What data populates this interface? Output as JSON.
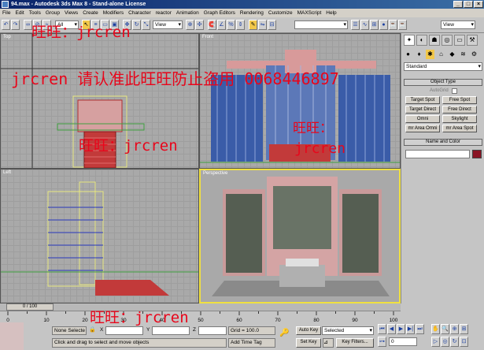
{
  "window": {
    "title": "94.max - Autodesk 3ds Max 8 - Stand-alone License",
    "min": "_",
    "max": "□",
    "close": "×"
  },
  "menu": [
    "File",
    "Edit",
    "Tools",
    "Group",
    "Views",
    "Create",
    "Modifiers",
    "Character",
    "reactor",
    "Animation",
    "Graph Editors",
    "Rendering",
    "Customize",
    "MAXScript",
    "Help"
  ],
  "toolbar": {
    "filter": "All",
    "refcoord": "View",
    "selset": "",
    "view2": "View"
  },
  "viewports": {
    "top": "Top",
    "front": "Front",
    "left": "Left",
    "perspective": "Perspective"
  },
  "cmdpanel": {
    "category": "Standard",
    "object_type": "Object Type",
    "autogrid": "AutoGrid",
    "buttons": [
      "Target Spot",
      "Free Spot",
      "Target Direct",
      "Free Direct",
      "Omni",
      "Skylight",
      "mr Area Omni",
      "mr Area Spot"
    ],
    "name_color": "Name and Color",
    "name_value": ""
  },
  "timeline": {
    "slider": "0 / 100",
    "ticks": [
      "0",
      "10",
      "20",
      "30",
      "40",
      "50",
      "60",
      "70",
      "80",
      "90",
      "100"
    ]
  },
  "status": {
    "selection": "None Selecte",
    "x_label": "X",
    "x_value": "",
    "y_label": "Y",
    "y_value": "",
    "z_label": "Z",
    "z_value": "",
    "grid": "Grid = 100.0",
    "prompt": "Click and drag to select and move objects",
    "add_time_tag": "Add Time Tag",
    "auto_key": "Auto Key",
    "set_key": "Set Key",
    "key_mode": "Selected",
    "key_filters": "Key Filters...",
    "frame": "0"
  },
  "watermarks": [
    "旺旺：jrcren",
    "jrcren 请认准此旺旺防止盗用 0068446897",
    "旺旺：jrcren",
    "旺旺：",
    "jrcren",
    "旺旺：jrcren"
  ],
  "colors": {
    "wm": "#e8061b",
    "viewport_bg": "#a9a9a9",
    "building_roof": "#d89a9a",
    "building_glass": "#3a5ca8",
    "persp_border": "#f0e040"
  }
}
